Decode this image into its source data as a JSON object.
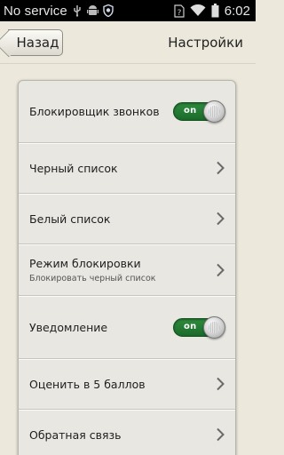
{
  "status_bar": {
    "carrier": "No service",
    "time": "6:02",
    "icons": [
      "usb-debug-icon",
      "android-icon",
      "shield-icon",
      "sim-missing-icon",
      "wifi-icon",
      "battery-icon"
    ]
  },
  "header": {
    "back_label": "Назад",
    "title": "Настройки"
  },
  "settings": {
    "items": [
      {
        "label": "Блокировщик звонков",
        "toggle": "on"
      },
      {
        "label": "Черный список"
      },
      {
        "label": "Белый список"
      },
      {
        "label": "Режим блокировки",
        "sublabel": "Блокировать черный список"
      },
      {
        "label": "Уведомление",
        "toggle": "on"
      },
      {
        "label": "Оценить в 5 баллов"
      },
      {
        "label": "Обратная связь"
      }
    ]
  },
  "colors": {
    "toggle_on": "#1f7a32",
    "background": "#ece9dc",
    "card": "#e9e7e2"
  }
}
